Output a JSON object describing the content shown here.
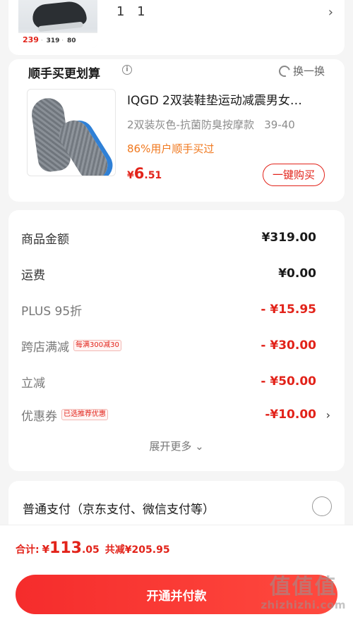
{
  "top_item": {
    "thumb_prices": [
      "239",
      "319",
      "80"
    ],
    "quantity": "1 1"
  },
  "addon": {
    "title": "顺手买更划算",
    "info_glyph": "i",
    "swap_label": "换一换",
    "product_name": "IQGD 2双装鞋垫运动减震男女…",
    "spec": "2双装灰色-抗菌防臭按摩款   39-40",
    "social_proof": "86%用户顺手买过",
    "price_currency": "¥",
    "price_int": "6",
    "price_dec": ".51",
    "buy_button": "一键购买"
  },
  "breakdown": {
    "rows": [
      {
        "label": "商品金额",
        "tag": "",
        "value": "¥319.00",
        "style": "normal"
      },
      {
        "label": "运费",
        "tag": "",
        "value": "¥0.00",
        "style": "normal"
      },
      {
        "label": "PLUS 95折",
        "tag": "",
        "value": "- ¥15.95",
        "style": "red"
      },
      {
        "label": "跨店满减",
        "tag": "每满300减30",
        "value": "- ¥30.00",
        "style": "red"
      },
      {
        "label": "立减",
        "tag": "",
        "value": "- ¥50.00",
        "style": "red"
      },
      {
        "label": "优惠券",
        "tag": "已选推荐优惠",
        "value": "-¥10.00",
        "style": "red"
      }
    ],
    "expand_more": "展开更多 ⌄"
  },
  "payment": {
    "method_label": "普通支付（京东支付、微信支付等）"
  },
  "footer": {
    "total_label": "合计:",
    "total_currency": "¥",
    "total_int": "113",
    "total_dec": ".05",
    "saved_text": "共减¥205.95",
    "pay_button": "开通并付款",
    "watermark_logo": "值值值",
    "watermark_site": "zhizhizhi.com"
  },
  "colors": {
    "accent_red": "#e2231a",
    "social_orange": "#f0781e",
    "background": "#f5f5f5"
  },
  "icons": [
    "info-icon",
    "refresh-icon",
    "chevron-right-icon",
    "chevron-down-icon",
    "radio-icon"
  ]
}
